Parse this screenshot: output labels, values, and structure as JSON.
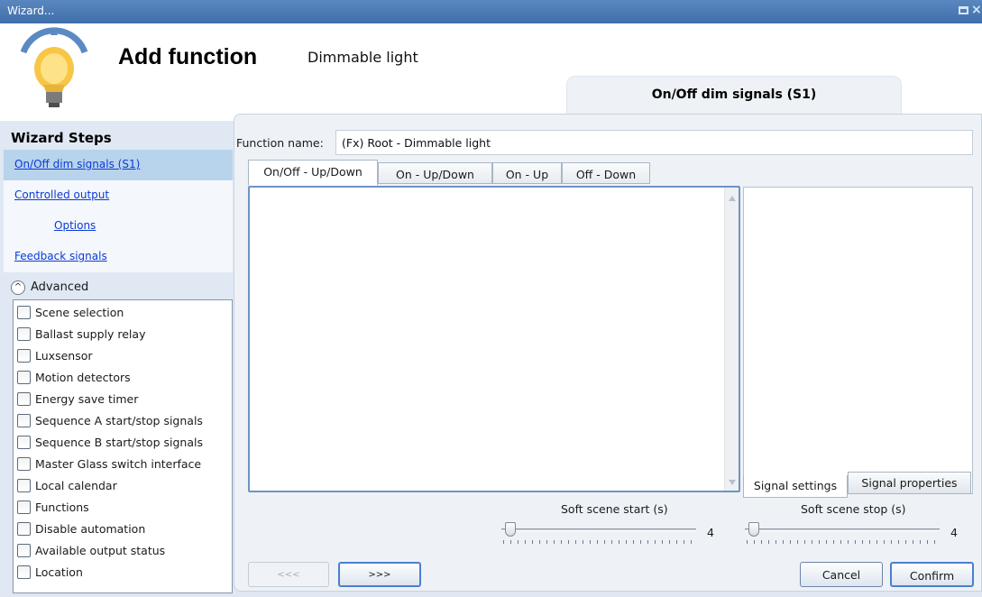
{
  "window": {
    "title": "Wizard..."
  },
  "header": {
    "title": "Add function",
    "function_type": "Dimmable light",
    "current_step_tab": "On/Off dim signals (S1)"
  },
  "wizard": {
    "title": "Wizard Steps",
    "steps": [
      {
        "label": "On/Off dim signals (S1)",
        "active": true
      },
      {
        "label": "Controlled output",
        "active": false
      },
      {
        "label": "Options",
        "active": false
      },
      {
        "label": "Feedback signals",
        "active": false
      }
    ],
    "advanced_label": "Advanced",
    "advanced_options": [
      {
        "label": "Scene selection",
        "checked": false
      },
      {
        "label": "Ballast supply relay",
        "checked": false
      },
      {
        "label": "Luxsensor",
        "checked": false
      },
      {
        "label": "Motion detectors",
        "checked": false
      },
      {
        "label": "Energy save timer",
        "checked": false
      },
      {
        "label": "Sequence A start/stop signals",
        "checked": false
      },
      {
        "label": "Sequence B start/stop signals",
        "checked": false
      },
      {
        "label": "Master Glass switch interface",
        "checked": false
      },
      {
        "label": "Local calendar",
        "checked": false
      },
      {
        "label": "Functions",
        "checked": false
      },
      {
        "label": "Disable automation",
        "checked": false
      },
      {
        "label": "Available output status",
        "checked": false
      },
      {
        "label": "Location",
        "checked": false
      }
    ]
  },
  "main": {
    "function_name_label": "Function name:",
    "function_name_value": "(Fx) Root - Dimmable light",
    "tabs": [
      {
        "label": "On/Off - Up/Down",
        "active": true
      },
      {
        "label": "On - Up/Down",
        "active": false
      },
      {
        "label": "On - Up",
        "active": false
      },
      {
        "label": "Off - Down",
        "active": false
      }
    ],
    "panel_tabs": {
      "settings": "Signal settings",
      "properties": "Signal properties"
    },
    "soft_scene_start": {
      "label": "Soft scene start (s)",
      "value": "4"
    },
    "soft_scene_stop": {
      "label": "Soft scene stop (s)",
      "value": "4"
    }
  },
  "footer": {
    "prev_label": "<<<",
    "next_label": ">>>",
    "cancel_label": "Cancel",
    "confirm_label": "Confirm"
  },
  "icons": [
    "lightbulb-icon",
    "maximize-icon",
    "close-icon",
    "collapse-up-icon",
    "scroll-up-icon",
    "scroll-down-icon"
  ],
  "colors": {
    "titlebar": "#4a7bb5",
    "link": "#0b3bd6",
    "active_step": "#b8d3ec",
    "focus_border": "#4b7fd0"
  }
}
